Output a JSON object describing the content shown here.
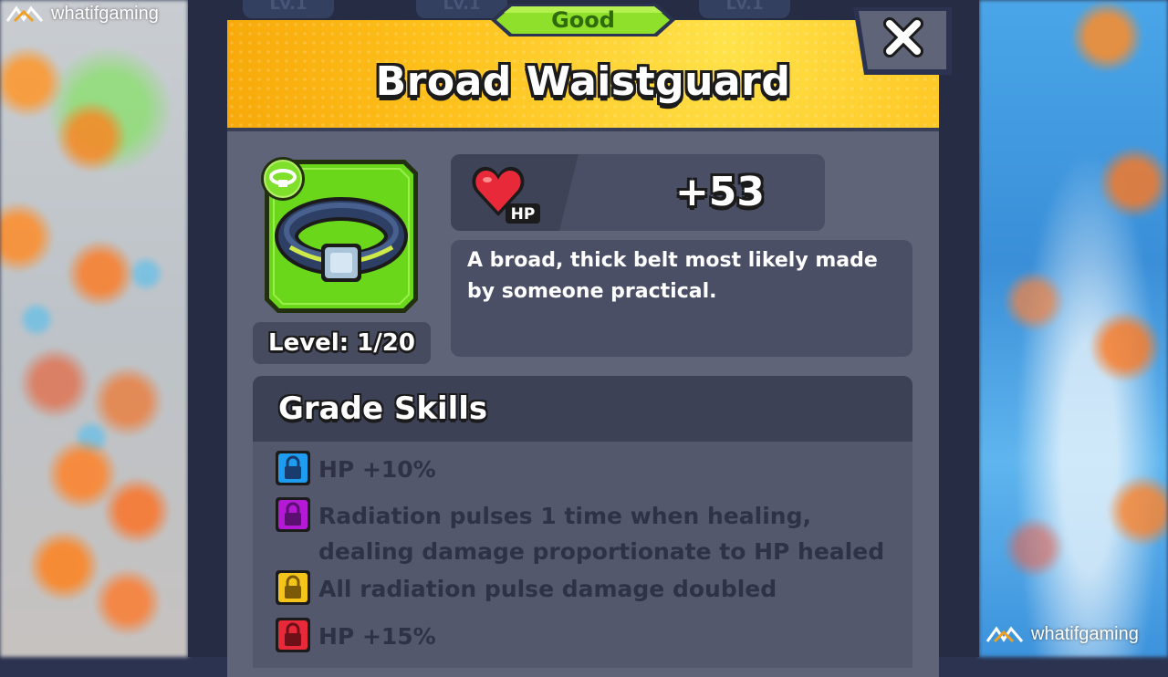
{
  "watermark": {
    "brand": "whatifgaming"
  },
  "background_tiles": [
    "Lv.1",
    "Lv.1",
    "Lv.1"
  ],
  "item": {
    "grade": "Good",
    "name": "Broad Waistguard",
    "level": "Level: 1/20",
    "stat_label": "HP",
    "stat_value": "+53",
    "description": "A broad, thick belt most likely made by someone practical."
  },
  "skills": {
    "title": "Grade Skills",
    "list": [
      {
        "text": "HP +10%",
        "color": "#1e9cf0",
        "icon": "lock-icon"
      },
      {
        "text": "Radiation pulses 1 time when healing, dealing damage proportionate to HP healed",
        "color": "#b419d6",
        "icon": "lock-icon"
      },
      {
        "text": "All radiation pulse damage doubled",
        "color": "#f4c41a",
        "icon": "lock-icon"
      },
      {
        "text": "HP +15%",
        "color": "#e8293a",
        "icon": "lock-icon"
      }
    ]
  },
  "colors": {
    "header_yellow": "#ffc21d",
    "grade_green": "#8ee02a",
    "item_green": "#6ad71a",
    "panel": "#5f6478"
  }
}
